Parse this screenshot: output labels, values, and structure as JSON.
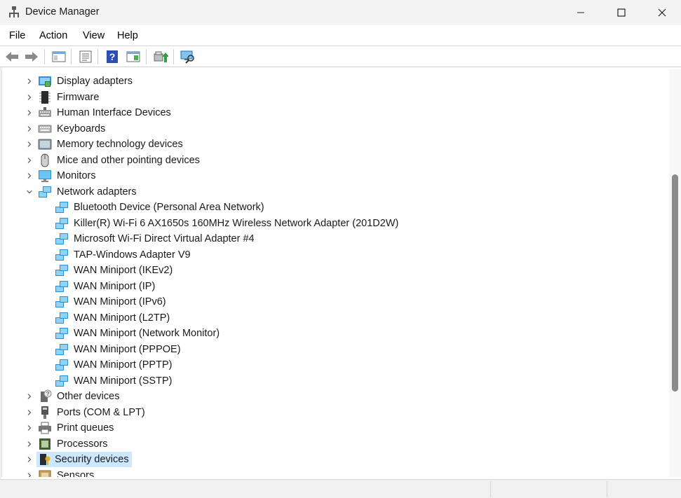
{
  "window": {
    "title": "Device Manager",
    "controls": {
      "minimize": "minimize",
      "maximize": "maximize",
      "close": "close"
    }
  },
  "menu": [
    "File",
    "Action",
    "View",
    "Help"
  ],
  "toolbar": {
    "buttons": [
      "back-icon",
      "forward-icon",
      "show-hide-console-tree-icon",
      "properties-icon",
      "help-icon",
      "action-pane-icon",
      "update-driver-icon",
      "scan-hardware-icon"
    ]
  },
  "tree": {
    "categories": [
      {
        "label": "Display adapters",
        "icon": "display-adapter-icon",
        "expanded": false
      },
      {
        "label": "Firmware",
        "icon": "firmware-icon",
        "expanded": false
      },
      {
        "label": "Human Interface Devices",
        "icon": "hid-icon",
        "expanded": false
      },
      {
        "label": "Keyboards",
        "icon": "keyboard-icon",
        "expanded": false
      },
      {
        "label": "Memory technology devices",
        "icon": "memory-device-icon",
        "expanded": false
      },
      {
        "label": "Mice and other pointing devices",
        "icon": "mouse-icon",
        "expanded": false
      },
      {
        "label": "Monitors",
        "icon": "monitor-icon",
        "expanded": false
      },
      {
        "label": "Network adapters",
        "icon": "network-adapter-icon",
        "expanded": true
      },
      {
        "label": "Other devices",
        "icon": "other-devices-icon",
        "expanded": false
      },
      {
        "label": "Ports (COM & LPT)",
        "icon": "port-icon",
        "expanded": false
      },
      {
        "label": "Print queues",
        "icon": "printer-icon",
        "expanded": false
      },
      {
        "label": "Processors",
        "icon": "processor-icon",
        "expanded": false
      },
      {
        "label": "Security devices",
        "icon": "security-device-icon",
        "expanded": false,
        "selected": true
      },
      {
        "label": "Sensors",
        "icon": "sensor-icon",
        "expanded": false
      }
    ],
    "network_adapters": [
      "Bluetooth Device (Personal Area Network)",
      "Killer(R) Wi-Fi 6 AX1650s 160MHz Wireless Network Adapter (201D2W)",
      "Microsoft Wi-Fi Direct Virtual Adapter #4",
      "TAP-Windows Adapter V9",
      "WAN Miniport (IKEv2)",
      "WAN Miniport (IP)",
      "WAN Miniport (IPv6)",
      "WAN Miniport (L2TP)",
      "WAN Miniport (Network Monitor)",
      "WAN Miniport (PPPOE)",
      "WAN Miniport (PPTP)",
      "WAN Miniport (SSTP)"
    ]
  },
  "colors": {
    "selection": "#cce8ff",
    "network_blue": "#2a8fd6",
    "scroll_thumb": "#8a8a8a"
  }
}
